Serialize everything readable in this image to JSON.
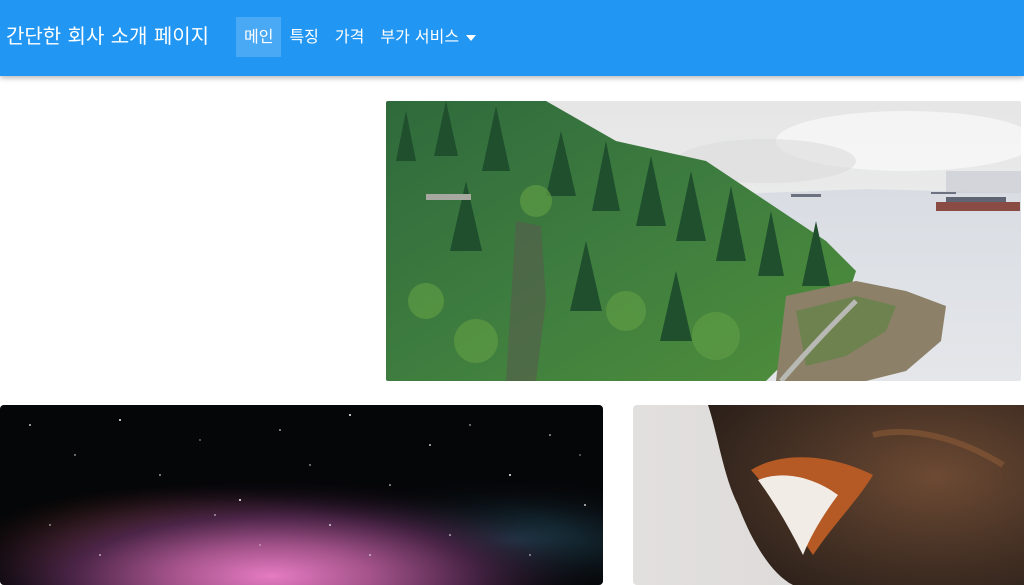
{
  "navbar": {
    "brand": "간단한 회사 소개 페이지",
    "items": [
      {
        "label": "메인",
        "active": true
      },
      {
        "label": "특징",
        "active": false
      },
      {
        "label": "가격",
        "active": false
      },
      {
        "label": "부가 서비스",
        "active": false,
        "dropdown": true
      }
    ]
  },
  "colors": {
    "navbar_bg": "#2196f3",
    "navbar_text": "#ffffff",
    "page_bg": "#ffffff"
  }
}
